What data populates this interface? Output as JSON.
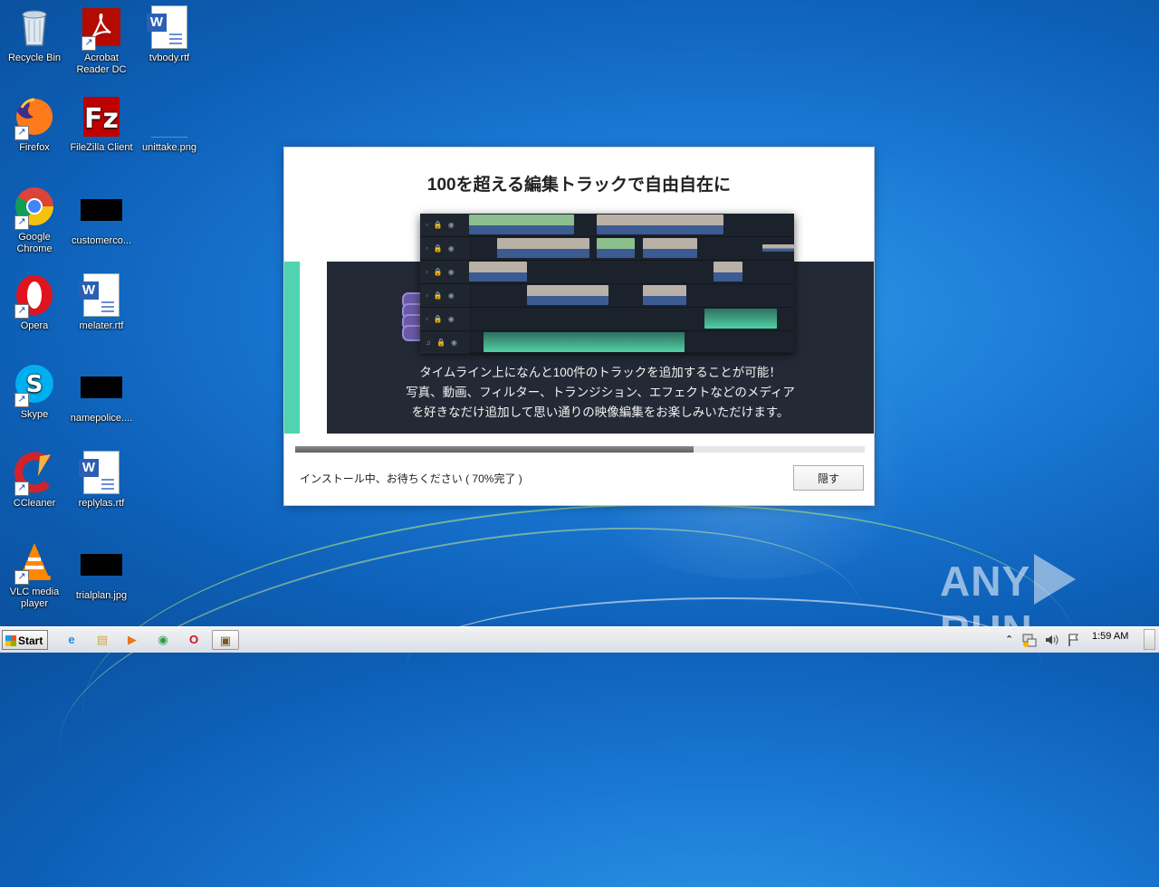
{
  "desktop": {
    "icons": [
      {
        "label": "Recycle Bin",
        "icon": "recycle-bin-icon"
      },
      {
        "label": "Acrobat Reader DC",
        "icon": "acrobat-reader-icon"
      },
      {
        "label": "tvbody.rtf",
        "icon": "word-document-icon"
      },
      {
        "label": "Firefox",
        "icon": "firefox-icon"
      },
      {
        "label": "FileZilla Client",
        "icon": "filezilla-icon"
      },
      {
        "label": "unittake.png",
        "icon": "image-file-icon"
      },
      {
        "label": "Google Chrome",
        "icon": "chrome-icon"
      },
      {
        "label": "customerco...",
        "icon": "black-file-icon"
      },
      {
        "label": "Opera",
        "icon": "opera-icon"
      },
      {
        "label": "melater.rtf",
        "icon": "word-document-icon"
      },
      {
        "label": "Skype",
        "icon": "skype-icon"
      },
      {
        "label": "namepolice....",
        "icon": "black-file-icon"
      },
      {
        "label": "CCleaner",
        "icon": "ccleaner-icon"
      },
      {
        "label": "replylas.rtf",
        "icon": "word-document-icon"
      },
      {
        "label": "VLC media player",
        "icon": "vlc-icon"
      },
      {
        "label": "trialplan.jpg",
        "icon": "black-file-icon"
      }
    ]
  },
  "installer": {
    "title": "100を超える編集トラックで自由自在に",
    "description_lines": [
      "タイムライン上になんと100件のトラックを追加することが可能！",
      "写真、動画、フィルター、トランジション、エフェクトなどのメディア",
      "を好きなだけ追加して思い通りの映像編集をお楽しみいただけます。"
    ],
    "progress_percent": 70,
    "status_text": "インストール中、お待ちください ( 70%完了 )",
    "hide_button_label": "隠す",
    "accent_color": "#4fd3b0"
  },
  "watermark": {
    "text_left": "ANY",
    "text_right": "RUN"
  },
  "taskbar": {
    "start_label": "Start",
    "pinned": [
      {
        "icon": "internet-explorer-icon",
        "glyph": "e"
      },
      {
        "icon": "file-explorer-icon",
        "glyph": "▤"
      },
      {
        "icon": "media-player-icon",
        "glyph": "▶"
      },
      {
        "icon": "chrome-icon",
        "glyph": "◉"
      },
      {
        "icon": "opera-icon",
        "glyph": "O"
      },
      {
        "icon": "installer-task-icon",
        "glyph": "▣"
      }
    ],
    "tray": {
      "expand_glyph": "⌃",
      "clock": "1:59 AM"
    }
  }
}
